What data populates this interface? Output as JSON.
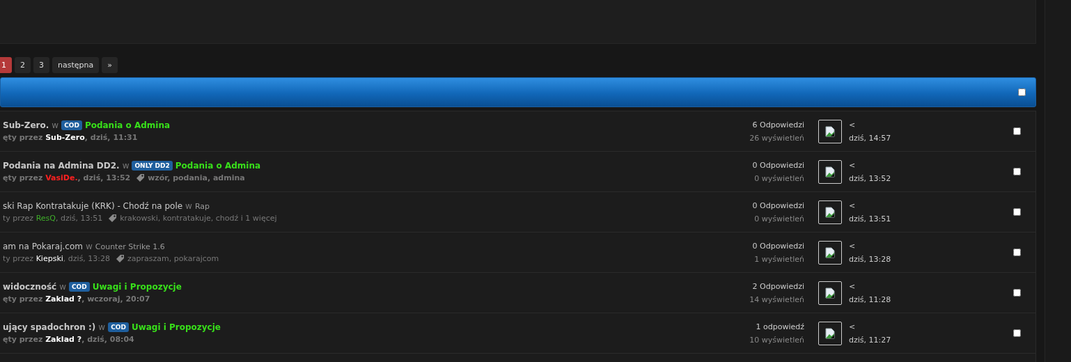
{
  "pagination": [
    {
      "label": "1",
      "selected": true
    },
    {
      "label": "2",
      "selected": false
    },
    {
      "label": "3",
      "selected": false
    },
    {
      "label": "następna",
      "selected": false
    },
    {
      "label": "»",
      "selected": false
    }
  ],
  "header": {
    "checked": false
  },
  "threads": [
    {
      "title": "Sub-Zero.",
      "in": "w",
      "prefix": "COD",
      "forum": "Podania o Admina",
      "unread": true,
      "started": "ęty przez",
      "author": {
        "name": "Sub-Zero",
        "color": "#ffffff"
      },
      "date": ", dziś, 11:31",
      "replies": "6 Odpowiedzi",
      "views": "26 wyświetleń",
      "last_user": "<",
      "last_date": "dziś, 14:57",
      "checked": false
    },
    {
      "title": "Podania na Admina DD2.",
      "in": "w",
      "prefix": "ONLY DD2",
      "forum": "Podania o Admina",
      "unread": true,
      "started": "ęty przez",
      "author": {
        "name": "VasiDe.",
        "color": "#ff2020"
      },
      "date": ", dziś, 13:52",
      "tags": "wzór, podania, admina",
      "replies": "0 Odpowiedzi",
      "views": "0 wyświetleń",
      "last_user": "<",
      "last_date": "dziś, 13:52",
      "checked": false
    },
    {
      "title": "ski Rap Kontratakuje (KRK) - Chodź na pole",
      "in": "w",
      "forum": "Rap",
      "unread": false,
      "started": "ty przez",
      "author": {
        "name": "ResQ",
        "color": "#3fae2a"
      },
      "date": ", dziś, 13:51",
      "tags": "krakowski, kontratakuje, chodź i 1 więcej",
      "replies": "0 Odpowiedzi",
      "views": "0 wyświetleń",
      "last_user": "<",
      "last_date": "dziś, 13:51",
      "checked": false
    },
    {
      "title": "am na Pokaraj.com",
      "in": "w",
      "forum": "Counter Strike 1.6",
      "unread": false,
      "started": "ty przez",
      "author": {
        "name": "Kiepski",
        "color": "#ffffff"
      },
      "date": ", dziś, 13:28",
      "tags": "zapraszam, pokarajcom",
      "replies": "0 Odpowiedzi",
      "views": "1 wyświetleń",
      "last_user": "<",
      "last_date": "dziś, 13:28",
      "checked": false
    },
    {
      "title": "widoczność",
      "in": "w",
      "prefix": "COD",
      "forum": "Uwagi i Propozycje",
      "unread": true,
      "started": "ęty przez",
      "author": {
        "name": "Zaklad ?",
        "color": "#ffffff"
      },
      "date": ", wczoraj, 20:07",
      "replies": "2 Odpowiedzi",
      "views": "14 wyświetleń",
      "last_user": "<",
      "last_date": "dziś, 11:28",
      "checked": false
    },
    {
      "title": "ujący spadochron :)",
      "in": "w",
      "prefix": "COD",
      "forum": "Uwagi i Propozycje",
      "unread": true,
      "started": "ęty przez",
      "author": {
        "name": "Zaklad ?",
        "color": "#ffffff"
      },
      "date": ", dziś, 08:04",
      "replies": "1 odpowiedź",
      "views": "10 wyświetleń",
      "last_user": "<",
      "last_date": "dziś, 11:27",
      "checked": false
    }
  ]
}
